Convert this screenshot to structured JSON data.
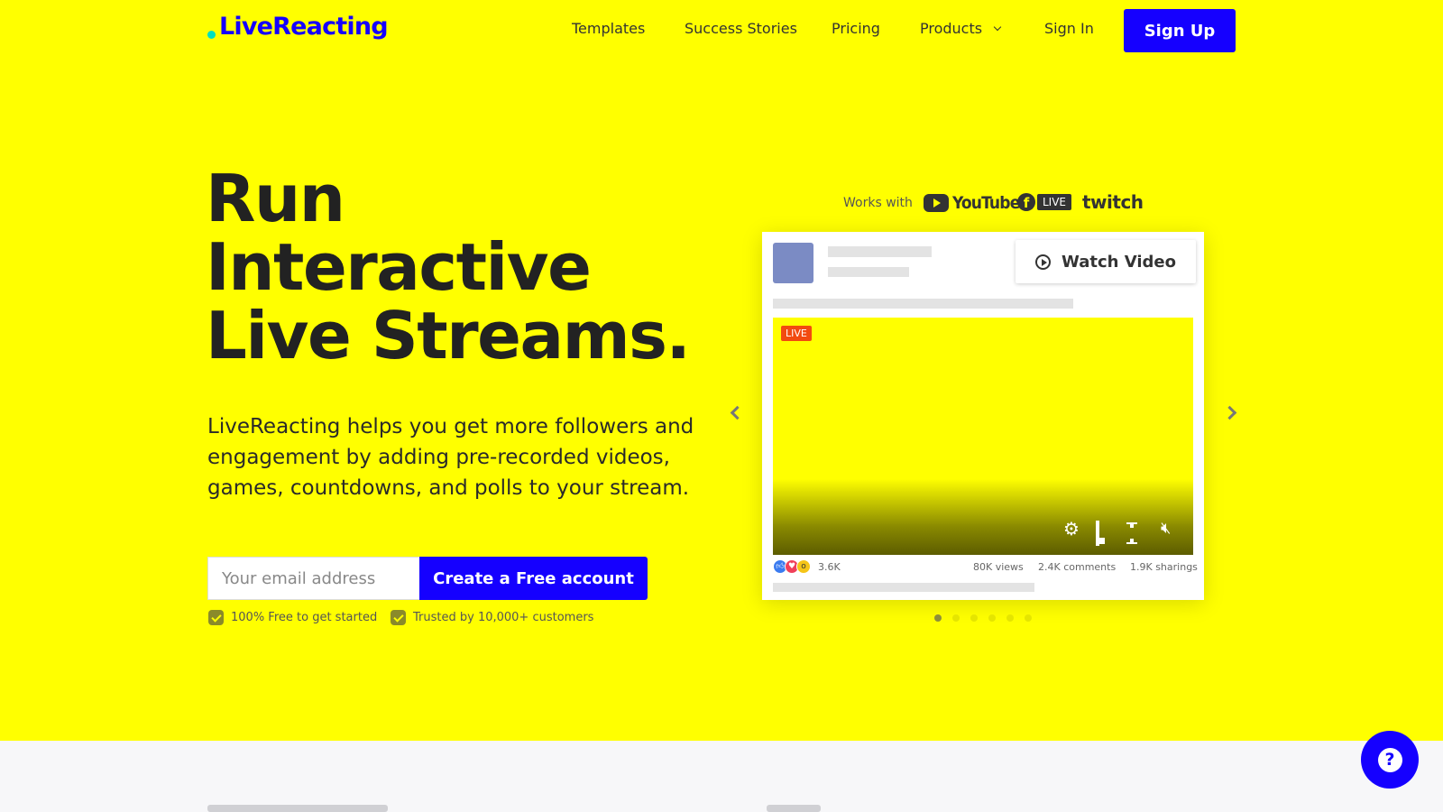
{
  "brand": {
    "name": "LiveReacting",
    "accent": "#1500ff",
    "hero_bg": "#ffff00"
  },
  "nav": {
    "templates": "Templates",
    "success_stories": "Success Stories",
    "pricing": "Pricing",
    "products": "Products",
    "sign_in": "Sign In",
    "sign_up": "Sign Up"
  },
  "hero": {
    "headline_1": "Run",
    "headline_2": "Interactive",
    "headline_3": "Live Streams.",
    "subtext": "LiveReacting helps you get more followers and engagement by adding pre-recorded videos, games, countdowns, and polls to your stream.",
    "email_placeholder": "Your email address",
    "cta": "Create a Free account",
    "trust_1": "100% Free to get started",
    "trust_2": "Trusted by 10,000+ customers"
  },
  "works_with": {
    "label": "Works with",
    "youtube": "YouTube",
    "facebook_live": "LIVE",
    "twitch": "twitch"
  },
  "preview": {
    "watch_video": "Watch Video",
    "live_badge": "LIVE",
    "reactions": "3.6K",
    "views": "80K views",
    "comments": "2.4K comments",
    "sharings": "1.9K sharings",
    "slide_count": 6,
    "active_slide": 1
  },
  "help": {
    "label": "?"
  }
}
